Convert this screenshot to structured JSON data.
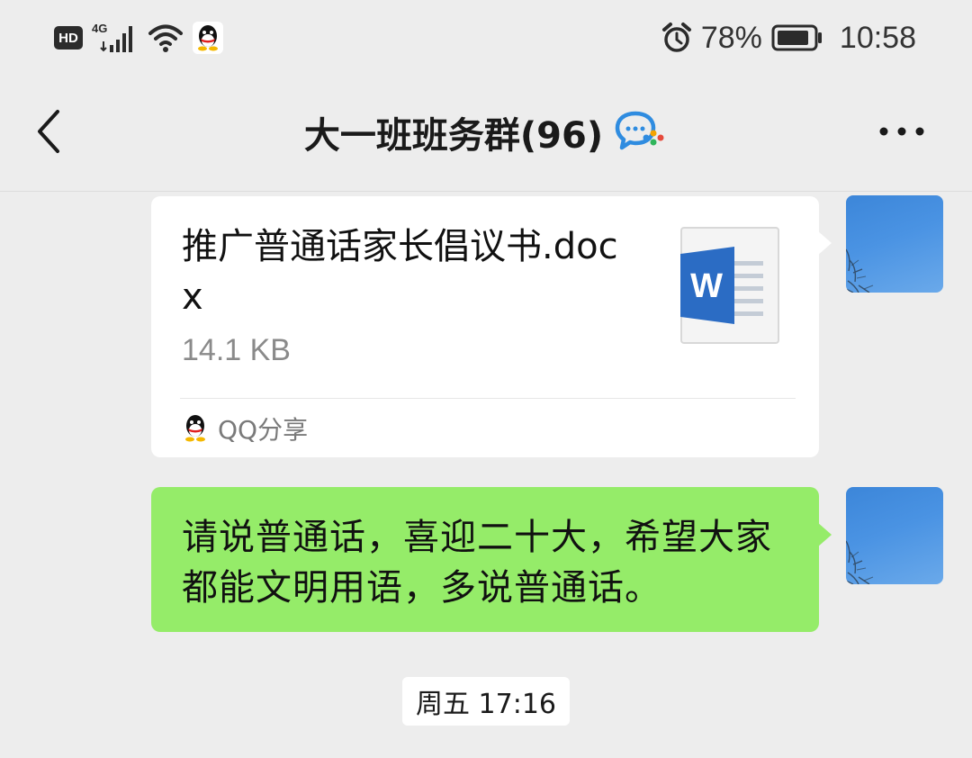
{
  "status_bar": {
    "hd_label": "HD",
    "network_label": "4G",
    "battery_percent": "78%",
    "time": "10:58",
    "icons": [
      "signal-icon",
      "wifi-icon",
      "qq-icon",
      "alarm-icon",
      "battery-icon"
    ]
  },
  "header": {
    "title": "大一班班务群(96)",
    "back_icon": "chevron-left-icon",
    "more_icon": "more-dots-icon",
    "chat_icon": "chat-bubble-icon"
  },
  "messages": [
    {
      "type": "file",
      "file_name": "推广普通话家长倡议书.docx",
      "file_size": "14.1 KB",
      "file_icon": "word-document-icon",
      "source_label": "QQ分享",
      "source_icon": "qq-icon"
    },
    {
      "type": "text",
      "text": "请说普通话，喜迎二十大，希望大家都能文明用语，多说普通话。"
    }
  ],
  "timestamp": "周五 17:16",
  "colors": {
    "background": "#ededed",
    "outgoing_bubble": "#95ec69",
    "card_bubble": "#ffffff",
    "avatar_sky": "#4a93e3"
  }
}
